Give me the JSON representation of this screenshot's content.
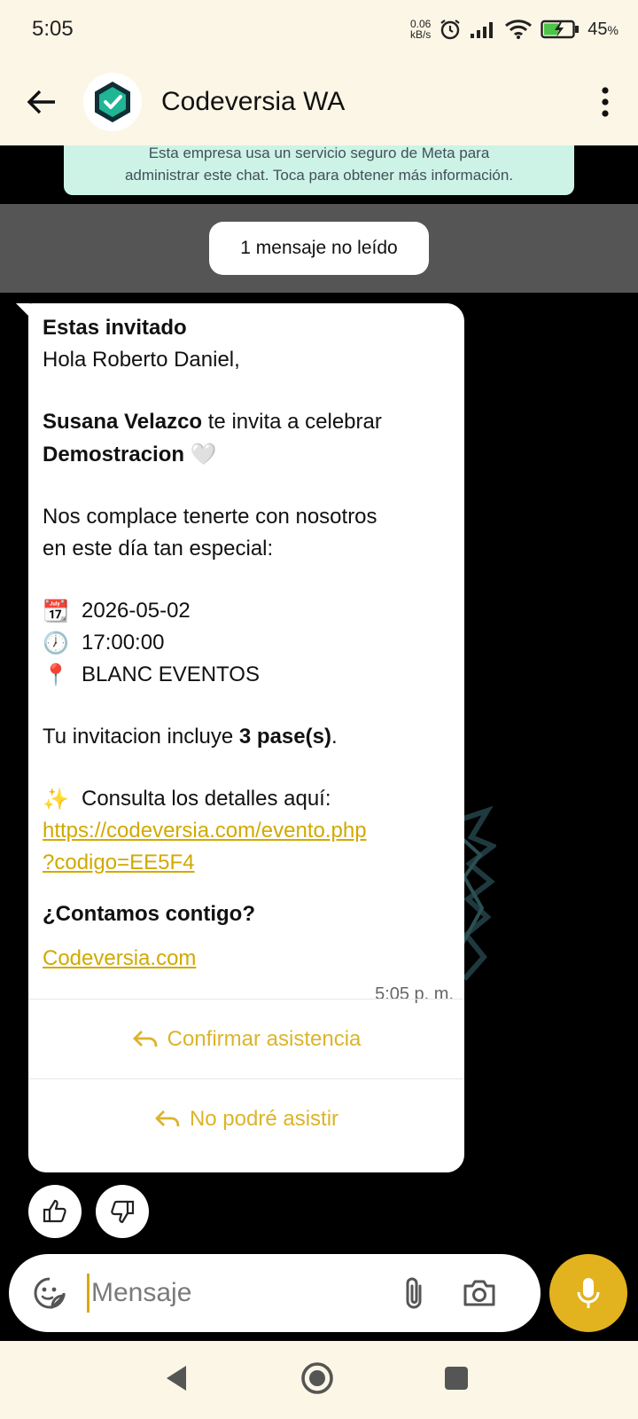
{
  "status_bar": {
    "time": "5:05",
    "net_speed_value": "0.06",
    "net_speed_unit": "kB/s",
    "battery_percent": "45",
    "battery_unit": "%"
  },
  "header": {
    "title": "Codeversia WA",
    "avatar_icon": "shield-check-icon"
  },
  "chat": {
    "meta_notice_line1": "Esta empresa usa un servicio seguro de Meta para",
    "meta_notice_line2": "administrar este chat. Toca para obtener más información.",
    "unread_label": "1 mensaje no leído",
    "message": {
      "title": "Estas invitado",
      "greeting": "Hola Roberto Daniel,",
      "host_name": "Susana Velazco",
      "invite_text": " te invita a celebrar",
      "event_name": "Demostracion",
      "heart": "🤍",
      "welcome_line1": "Nos complace tenerte con nosotros",
      "welcome_line2": "en este día tan especial:",
      "date_emoji": "📆",
      "date": "2026-05-02",
      "time_emoji": "🕖",
      "time": "17:00:00",
      "place_emoji": "📍",
      "place": "BLANC EVENTOS",
      "passes_prefix": "Tu invitacion incluye ",
      "passes_value": "3 pase(s)",
      "passes_suffix": ".",
      "sparkle_emoji": "✨",
      "details_label": "Consulta los detalles aquí:",
      "link_line1": "https://codeversia.com/evento.php",
      "link_line2": "?codigo=EE5F4",
      "question": "¿Contamos contigo?",
      "footer_link": "Codeversia.com",
      "timestamp": "5:05 p. m."
    },
    "quick_replies": [
      {
        "label": "Confirmar asistencia"
      },
      {
        "label": "No podré asistir"
      }
    ]
  },
  "composer": {
    "placeholder": "Mensaje"
  },
  "colors": {
    "accent": "#e3b21f",
    "bar_background": "#fbf6e6",
    "notice_background": "#cdf3e6"
  }
}
